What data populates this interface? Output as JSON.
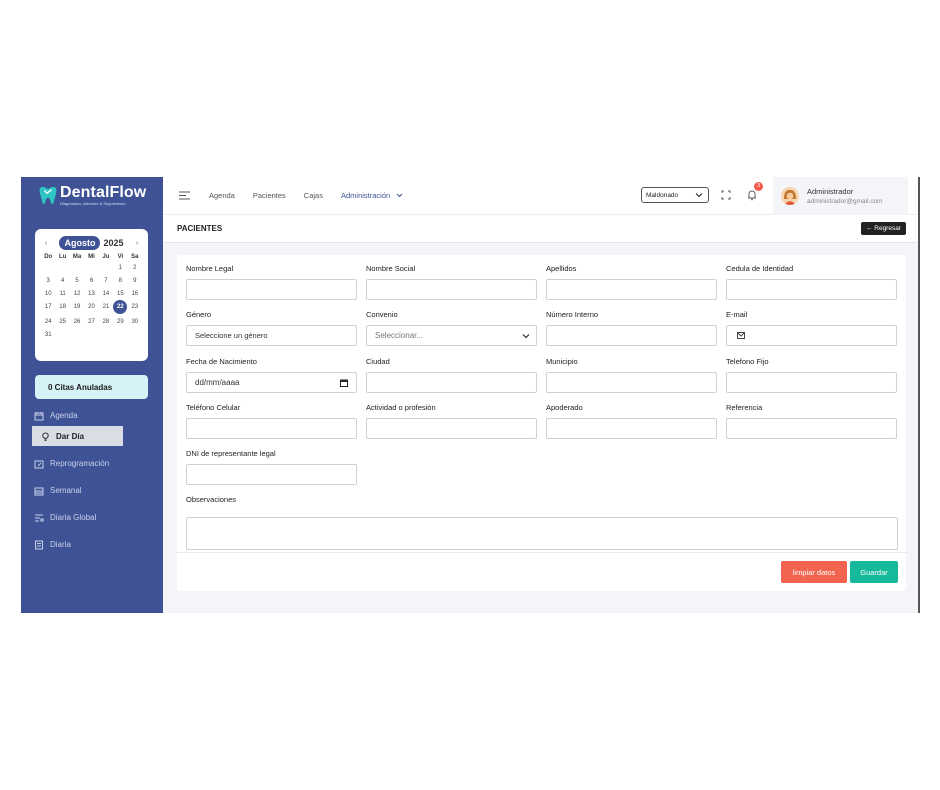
{
  "brand": {
    "name": "DentalFlow",
    "tagline": "Diagnostico, Atención & Seguimiento",
    "accent": "#3e5295"
  },
  "calendar": {
    "prev": "‹",
    "next": "›",
    "month": "Agosto",
    "year": "2025",
    "weekdays": [
      "Do",
      "Lu",
      "Ma",
      "Mi",
      "Ju",
      "Vi",
      "Sa"
    ],
    "days": [
      "",
      "",
      "",
      "",
      "",
      "1",
      "2",
      "3",
      "4",
      "5",
      "6",
      "7",
      "8",
      "9",
      "10",
      "11",
      "12",
      "13",
      "14",
      "15",
      "16",
      "17",
      "18",
      "19",
      "20",
      "21",
      "22",
      "23",
      "24",
      "25",
      "26",
      "27",
      "28",
      "29",
      "30",
      "31"
    ],
    "selected": "22"
  },
  "sidebar": {
    "anuladas": "0 Citas Anuladas",
    "items": [
      {
        "label": "Agenda",
        "icon": "calendar-icon"
      },
      {
        "label": "Dar Día",
        "icon": "lightbulb-icon"
      },
      {
        "label": "Reprogramación",
        "icon": "calendar-edit-icon"
      },
      {
        "label": "Semanal",
        "icon": "calendar-week-icon"
      },
      {
        "label": "Diaria Global",
        "icon": "filter-list-icon"
      },
      {
        "label": "Diaria",
        "icon": "list-icon"
      }
    ]
  },
  "topbar": {
    "nav": [
      "Agenda",
      "Pacientes",
      "Cajas",
      "Administración"
    ],
    "branch": "Maldonado",
    "notifications": "3",
    "user_name": "Administrador",
    "user_email": "administrador@gmail.com"
  },
  "page": {
    "title": "PACIENTES",
    "back": "← Regresar"
  },
  "form": {
    "nombre_legal": "Nombre Legal",
    "nombre_social": "Nombre Social",
    "apellidos": "Apellidos",
    "cedula": "Cedula de Identidad",
    "genero": "Género",
    "genero_value": "Seleccione un género",
    "convenio": "Convenio",
    "convenio_placeholder": "Seleccionar...",
    "numero_interno": "Número Interno",
    "email": "E-mail",
    "fecha_nacimiento": "Fecha de Nacimiento",
    "fecha_placeholder": "dd/mm/aaaa",
    "ciudad": "Ciudad",
    "municipio": "Municipio",
    "telefono_fijo": "Telefono Fijo",
    "telefono_celular": "Teléfono Celular",
    "actividad": "Actividad o profesión",
    "apoderado": "Apoderado",
    "referencia": "Referencia",
    "dni_representante": "DNI de representante legal",
    "observaciones": "Observaciones"
  },
  "actions": {
    "clear": "limpiar datos",
    "save": "Guardar",
    "clear_color": "#f16550",
    "save_color": "#17b99b"
  }
}
